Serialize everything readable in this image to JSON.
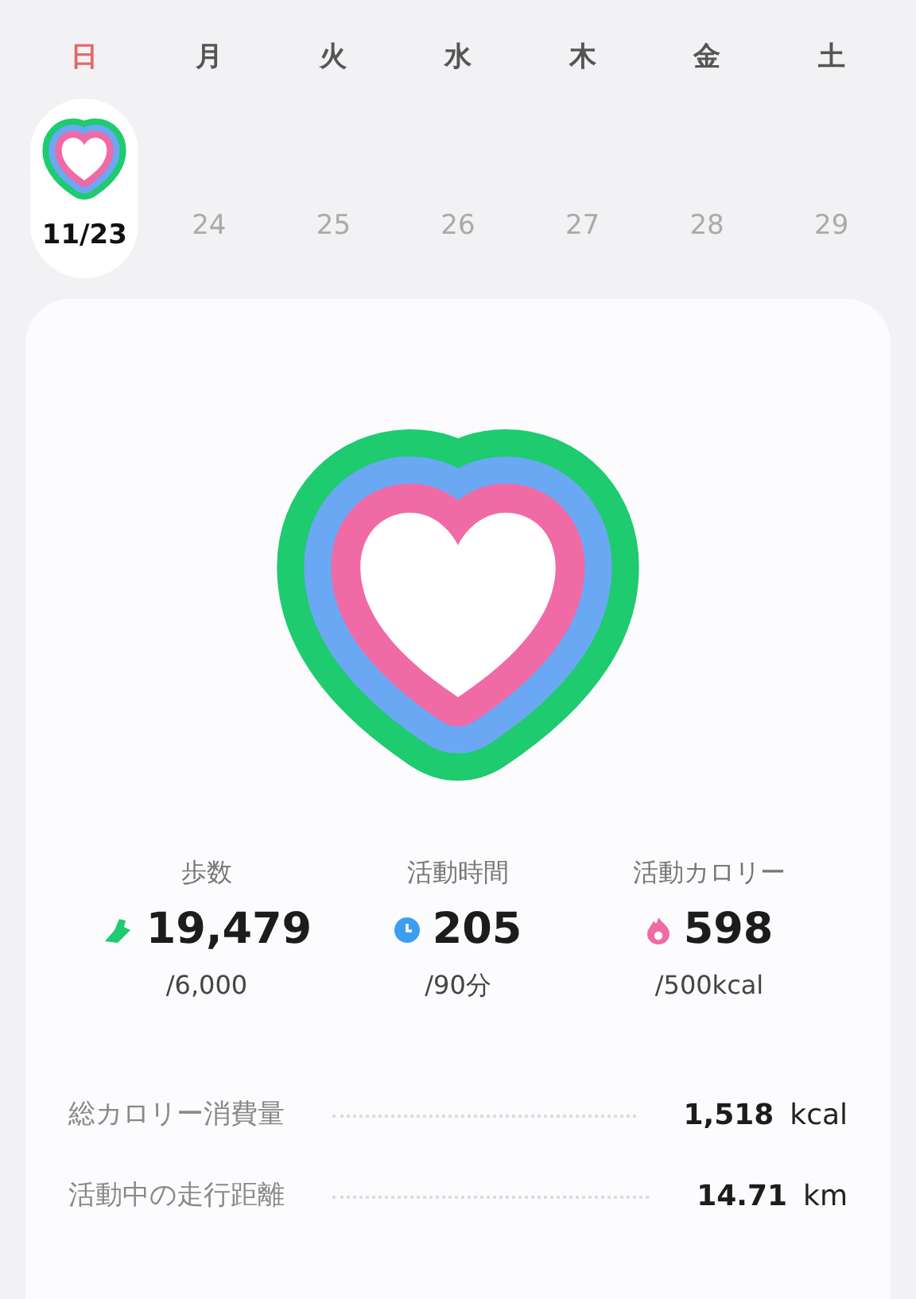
{
  "week": [
    {
      "weekday": "日",
      "date": "11/23",
      "selected": true,
      "color": "#e06b6b"
    },
    {
      "weekday": "月",
      "date": "24",
      "selected": false,
      "color": "#555555"
    },
    {
      "weekday": "火",
      "date": "25",
      "selected": false,
      "color": "#555555"
    },
    {
      "weekday": "水",
      "date": "26",
      "selected": false,
      "color": "#555555"
    },
    {
      "weekday": "木",
      "date": "27",
      "selected": false,
      "color": "#555555"
    },
    {
      "weekday": "金",
      "date": "28",
      "selected": false,
      "color": "#555555"
    },
    {
      "weekday": "土",
      "date": "29",
      "selected": false,
      "color": "#555555"
    }
  ],
  "stats": [
    {
      "kind": "steps",
      "label": "歩数",
      "value": "19,479",
      "goal": "/6,000"
    },
    {
      "kind": "time",
      "label": "活動時間",
      "value": "205",
      "goal": "/90分"
    },
    {
      "kind": "calories",
      "label": "活動カロリー",
      "value": "598",
      "goal": "/500kcal"
    }
  ],
  "details": [
    {
      "label": "総カロリー消費量",
      "value": "1,518",
      "unit": "kcal"
    },
    {
      "label": "活動中の走行距離",
      "value": "14.71",
      "unit": "km"
    }
  ]
}
